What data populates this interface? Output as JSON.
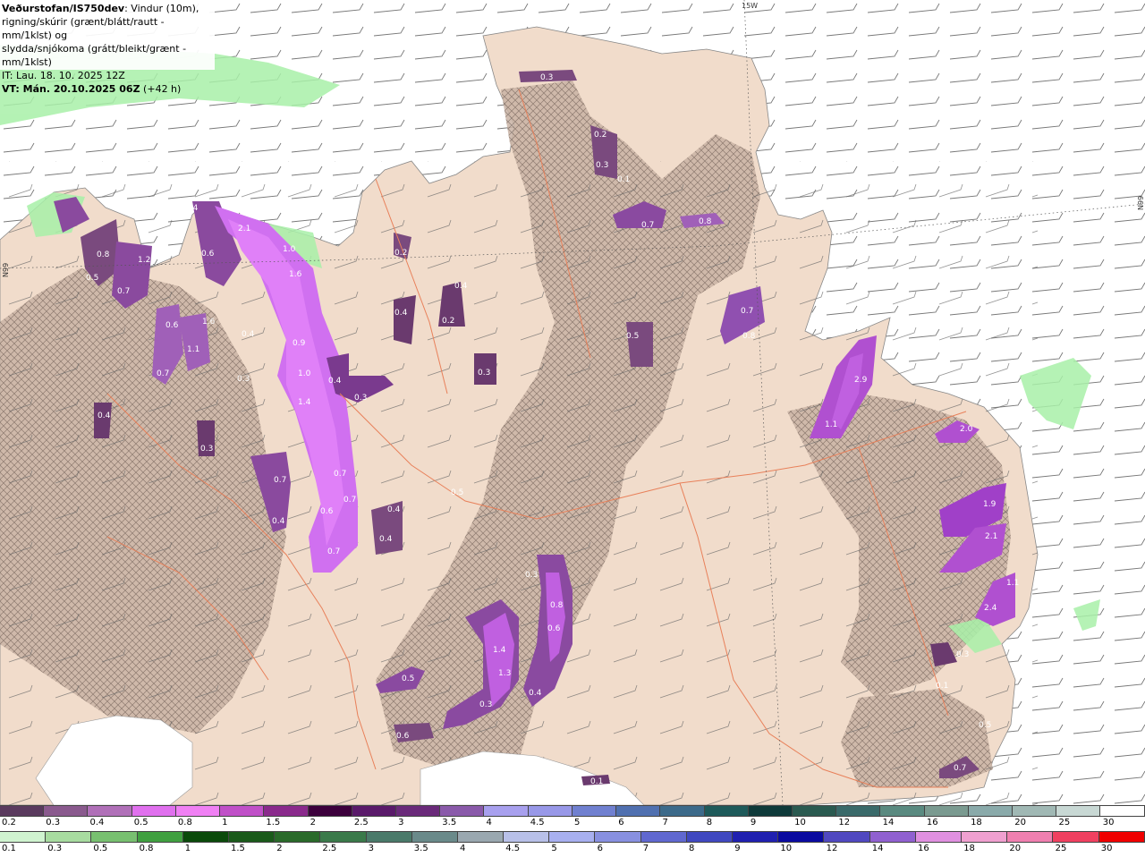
{
  "info": {
    "brand": "Veðurstofan/IS750dev",
    "desc_line1": ": Vindur (10m),",
    "desc_line2": "rigning/skúrir (grænt/blátt/rautt - mm/1klst) og",
    "desc_line3": "slydda/snjókoma (grátt/bleikt/grænt - mm/1klst)",
    "it_line": "IT: Lau. 18. 10. 2025 12Z",
    "vt_bold": "VT: Mán. 20.10.2025 06Z",
    "vt_offset": " (+42 h)"
  },
  "coords": [
    "15W",
    "N99",
    "N99"
  ],
  "precip_labels": [
    "0.3",
    "0.2",
    "0.3",
    "0.1",
    "0.7",
    "0.8",
    "0.5",
    "0.2",
    "0.4",
    "0.2",
    "0.4",
    "0.5",
    "0.3",
    "0.7",
    "0.8",
    "2.9",
    "1.1",
    "2.0",
    "1.9",
    "2.1",
    "1.1",
    "2.4",
    "0.3",
    "0.1",
    "0.7",
    "0.5",
    "0.4",
    "2.1",
    "0.6",
    "1.0",
    "1.6",
    "0.9",
    "1.0",
    "1.4",
    "0.4",
    "0.3",
    "0.7",
    "0.7",
    "0.6",
    "0.4",
    "0.4",
    "0.7",
    "0.8",
    "1.2",
    "0.5",
    "0.7",
    "0.6",
    "1.1",
    "1.6",
    "0.7",
    "0.4",
    "0.3",
    "0.4",
    "0.3",
    "0.7",
    "0.4",
    "0.3",
    "0.8",
    "0.6",
    "1.4",
    "1.3",
    "0.4",
    "0.3",
    "0.5",
    "0.6",
    "0.1"
  ],
  "legend_snow": {
    "ticks": [
      "0.2",
      "0.3",
      "0.4",
      "0.5",
      "0.8",
      "1",
      "1.5",
      "2",
      "2.5",
      "3",
      "3.5",
      "4",
      "4.5",
      "5",
      "6",
      "7",
      "8",
      "9",
      "10",
      "12",
      "14",
      "16",
      "18",
      "20",
      "25",
      "30"
    ],
    "colors": [
      "#5a3a5e",
      "#8a5a8e",
      "#b070b8",
      "#e070ee",
      "#f080f4",
      "#c050c8",
      "#8a2a8c",
      "#3c003c",
      "#5a1a6a",
      "#6a2a7a",
      "#8a5aaa",
      "#a8a0ee",
      "#9898e8",
      "#7080d0",
      "#5070b0",
      "#3c6a8a",
      "#1e5a5a",
      "#0e3a3a",
      "#2a5a50",
      "#3a6a6a",
      "#5a8a80",
      "#7a9a90",
      "#8aaaaa",
      "#a0b8b4",
      "#c8d8d4",
      "#ffffff"
    ]
  },
  "legend_rain": {
    "ticks": [
      "0.1",
      "0.3",
      "0.5",
      "0.8",
      "1",
      "1.5",
      "2",
      "2.5",
      "3",
      "3.5",
      "4",
      "4.5",
      "5",
      "6",
      "7",
      "8",
      "9",
      "10",
      "12",
      "14",
      "16",
      "18",
      "20",
      "25",
      "30"
    ],
    "colors": [
      "#d0f4d0",
      "#a8dca0",
      "#78c070",
      "#40a040",
      "#0a4a0a",
      "#1a5a1a",
      "#2a6a2a",
      "#3a7a4a",
      "#4a7a6a",
      "#6a8a8a",
      "#9aa8b0",
      "#b8c0e8",
      "#a8b0f0",
      "#8890e0",
      "#6068d0",
      "#4048c0",
      "#2020b0",
      "#0a0aa0",
      "#5048c0",
      "#9060d0",
      "#e090e0",
      "#f0a0d0",
      "#f080b0",
      "#f04060",
      "#f00000"
    ]
  }
}
